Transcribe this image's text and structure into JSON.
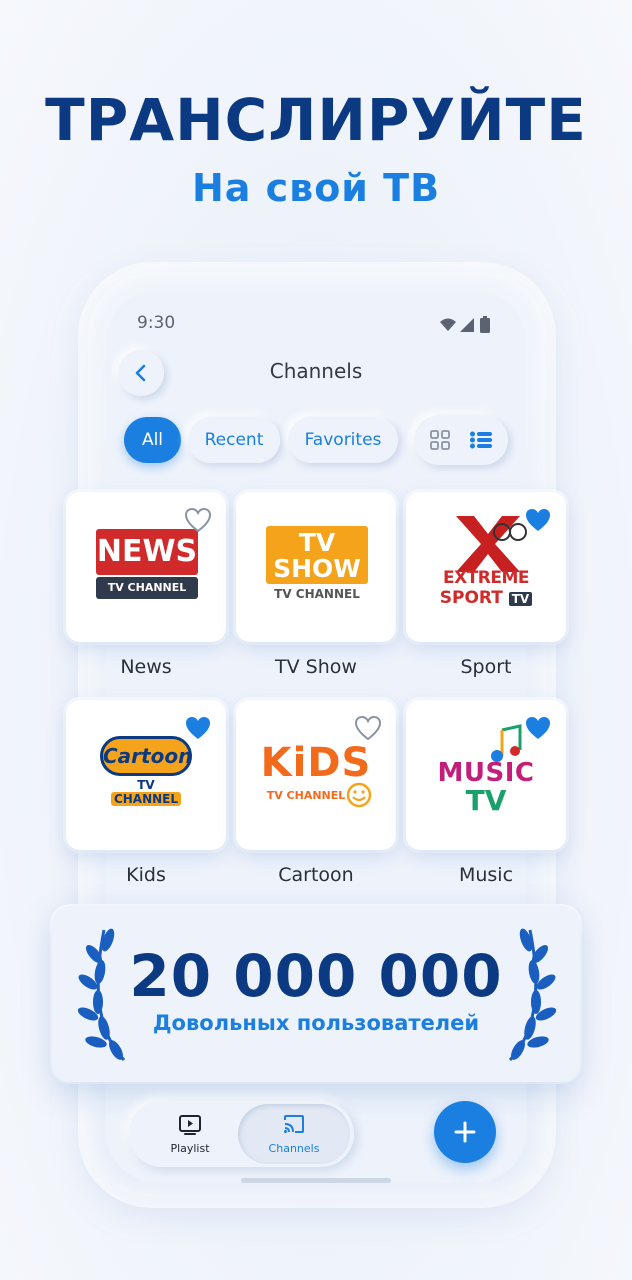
{
  "promo": {
    "headline": "ТРАНСЛИРУЙТЕ",
    "subheadline": "На свой ТВ"
  },
  "status_bar": {
    "time": "9:30"
  },
  "header": {
    "title": "Channels"
  },
  "filters": {
    "tabs": [
      {
        "label": "All",
        "active": true
      },
      {
        "label": "Recent",
        "active": false
      },
      {
        "label": "Favorites",
        "active": false
      }
    ],
    "view_mode": "list"
  },
  "channels": [
    {
      "label": "News",
      "favorite": false,
      "logo": {
        "line1": "NEWS",
        "line2": "TV CHANNEL"
      }
    },
    {
      "label": "TV Show",
      "favorite": false,
      "logo": {
        "line1": "TV",
        "line2": "SHOW",
        "line3": "TV CHANNEL"
      }
    },
    {
      "label": "Sport",
      "favorite": true,
      "logo": {
        "line1": "EXTREME",
        "line2": "SPORT",
        "line3": "TV"
      }
    },
    {
      "label": "Kids",
      "favorite": true,
      "logo": {
        "line1": "Cartoon",
        "line2": "TV",
        "line3": "CHANNEL"
      }
    },
    {
      "label": "Cartoon",
      "favorite": false,
      "logo": {
        "line1": "KiDS",
        "line2": "TV CHANNEL"
      }
    },
    {
      "label": "Music",
      "favorite": true,
      "logo": {
        "line1": "MUSIC",
        "line2": "TV"
      }
    }
  ],
  "banner": {
    "number": "20 000 000",
    "caption": "Довольных пользователей"
  },
  "bottom_nav": {
    "items": [
      {
        "label": "Playlist",
        "icon": "play-screen-icon",
        "active": false
      },
      {
        "label": "Channels",
        "icon": "cast-icon",
        "active": true
      }
    ],
    "fab_icon": "plus-icon"
  },
  "colors": {
    "navy": "#0c3a82",
    "accent": "#1a7fe0",
    "background": "#eef3fb",
    "news_red": "#d12a2a",
    "tvshow_orange": "#f4a31b",
    "kids_orange": "#f26a1b"
  }
}
